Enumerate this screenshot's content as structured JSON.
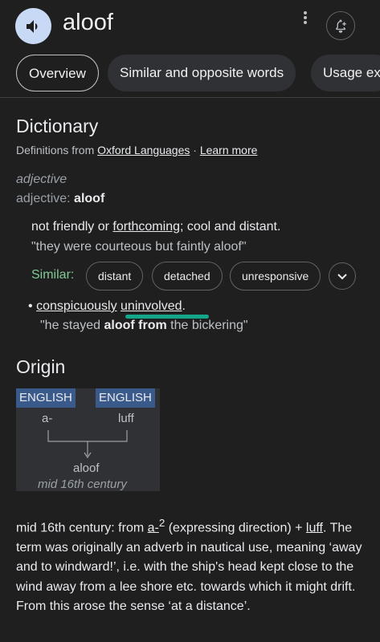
{
  "header": {
    "word": "aloof",
    "speaker_icon": "volume-icon",
    "more_icon": "more-vert-icon",
    "alert_icon": "notification-add-icon"
  },
  "tabs": [
    {
      "label": "Overview",
      "active": true
    },
    {
      "label": "Similar and opposite words",
      "active": false
    },
    {
      "label": "Usage ex",
      "active": false
    }
  ],
  "dictionary": {
    "title": "Dictionary",
    "source_prefix": "Definitions from ",
    "source_link": "Oxford Languages",
    "separator": " · ",
    "learn_more": "Learn more",
    "part_of_speech": "adjective",
    "pos_prefix": "adjective: ",
    "pos_word": "aloof",
    "definition_pre": "not friendly or ",
    "definition_link": "forthcoming",
    "definition_post": "; cool and distant.",
    "example": "\"they were courteous but faintly aloof\"",
    "similar_label": "Similar:",
    "similar_chips": [
      "distant",
      "detached",
      "unresponsive"
    ],
    "sense2_link1": "conspicuously",
    "sense2_link2": "uninvolved",
    "sense2_end": ".",
    "example2_pre": "\"he stayed ",
    "example2_bold": "aloof from",
    "example2_post": " the bickering\""
  },
  "origin": {
    "title": "Origin",
    "lang1": "ENGLISH",
    "lang2": "ENGLISH",
    "root1": "a-",
    "root2": "luff",
    "result_word": "aloof",
    "result_date": "mid 16th century",
    "para_start": "mid 16th century: from ",
    "para_link1": "a-",
    "para_sup": "2",
    "para_mid": " (expressing direction) + ",
    "para_link2": "luff",
    "para_rest": ". The term was originally an adverb in nautical use, meaning ‘away and to windward!’, i.e. with the ship's head kept close to the wind away from a lee shore etc. towards which it might drift. From this arose the sense ‘at a distance’."
  },
  "colors": {
    "background": "#1f1f1f",
    "similar_label": "#81c995",
    "highlight": "#14a68a",
    "lang_tag": "#3b5a8c",
    "speaker_bg": "#c8d9f5"
  }
}
